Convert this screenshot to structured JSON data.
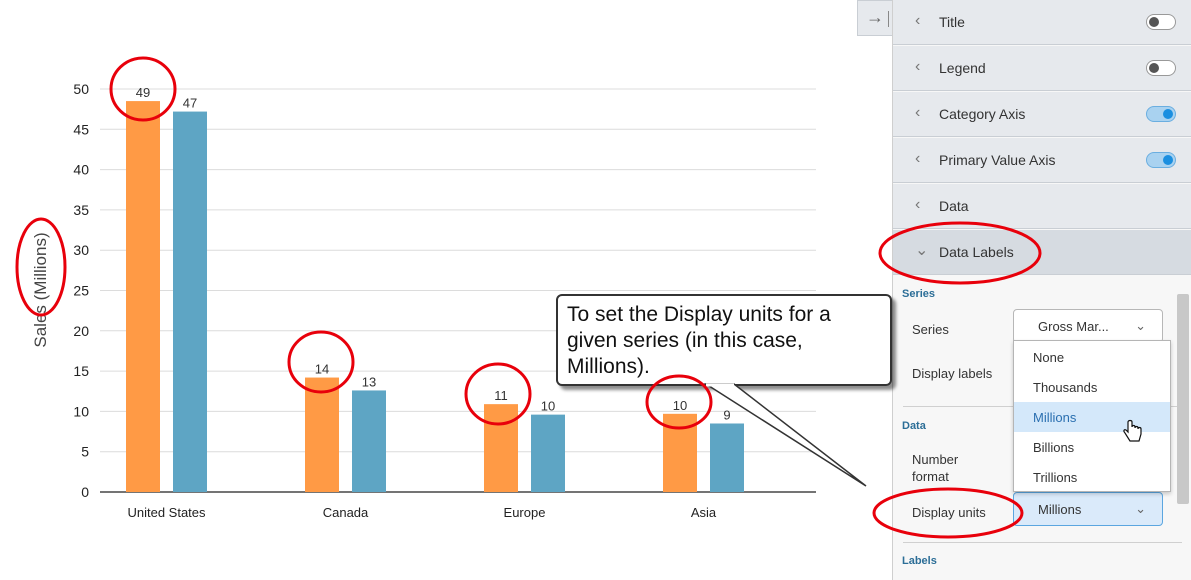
{
  "chart_data": {
    "type": "bar",
    "categories": [
      "United States",
      "Canada",
      "Europe",
      "Asia"
    ],
    "series": [
      {
        "values": [
          48.5,
          14.2,
          10.9,
          9.7
        ],
        "labels": [
          "49",
          "14",
          "11",
          "10"
        ],
        "color": "#ff9a45"
      },
      {
        "values": [
          47.2,
          12.6,
          9.6,
          8.5
        ],
        "labels": [
          "47",
          "13",
          "10",
          "9"
        ],
        "color": "#5ea5c4"
      }
    ],
    "ylabel": "Sales (Millions)",
    "ylim": [
      0,
      50
    ],
    "yticks": [
      "0",
      "5",
      "10",
      "15",
      "20",
      "25",
      "30",
      "35",
      "40",
      "45",
      "50"
    ],
    "grid": true
  },
  "panel": {
    "collapse_icon": "arrow-right-icon",
    "sections": [
      {
        "label": "Title",
        "toggle": "off"
      },
      {
        "label": "Legend",
        "toggle": "off"
      },
      {
        "label": "Category Axis",
        "toggle": "on"
      },
      {
        "label": "Primary Value Axis",
        "toggle": "on"
      },
      {
        "label": "Data"
      },
      {
        "label": "Data Labels",
        "expanded": true
      }
    ],
    "series_heading": "Series",
    "series_label": "Series",
    "series_value": "Gross Mar...",
    "display_labels_label": "Display labels",
    "data_heading": "Data",
    "number_format_label": "Number format",
    "display_units_label": "Display units",
    "display_units_value": "Millions",
    "labels_heading": "Labels",
    "dropdown_options": [
      "None",
      "Thousands",
      "Millions",
      "Billions",
      "Trillions"
    ],
    "dropdown_selected": "Millions"
  },
  "callout": {
    "text": "To set the Display units for a given series (in this case, Millions)."
  },
  "colors": {
    "annotation_red": "#e8000b",
    "toggle_on": "#1b8fe0",
    "bar_orange": "#ff9a45",
    "bar_blue": "#5ea5c4"
  }
}
